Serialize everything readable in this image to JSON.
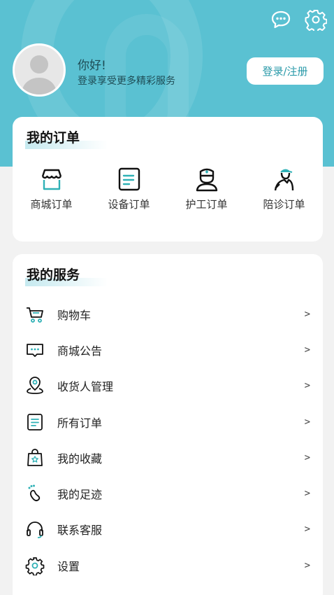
{
  "header": {
    "greeting": "你好!",
    "subtitle": "登录享受更多精彩服务",
    "login_label": "登录/注册"
  },
  "orders": {
    "title": "我的订单",
    "items": [
      {
        "label": "商城订单",
        "icon": "shop-icon"
      },
      {
        "label": "设备订单",
        "icon": "document-icon"
      },
      {
        "label": "护工订单",
        "icon": "nurse-icon"
      },
      {
        "label": "陪诊订单",
        "icon": "escort-icon"
      }
    ]
  },
  "services": {
    "title": "我的服务",
    "arrow": ">",
    "items": [
      {
        "label": "购物车",
        "icon": "cart-icon"
      },
      {
        "label": "商城公告",
        "icon": "message-icon"
      },
      {
        "label": "收货人管理",
        "icon": "location-icon"
      },
      {
        "label": "所有订单",
        "icon": "list-icon"
      },
      {
        "label": "我的收藏",
        "icon": "favorite-bag-icon"
      },
      {
        "label": "我的足迹",
        "icon": "footprint-icon"
      },
      {
        "label": "联系客服",
        "icon": "headset-icon"
      },
      {
        "label": "设置",
        "icon": "gear-icon"
      }
    ]
  },
  "colors": {
    "accent": "#5ac1d2",
    "icon_accent": "#2fb1b6",
    "background": "#f2f2f2"
  }
}
